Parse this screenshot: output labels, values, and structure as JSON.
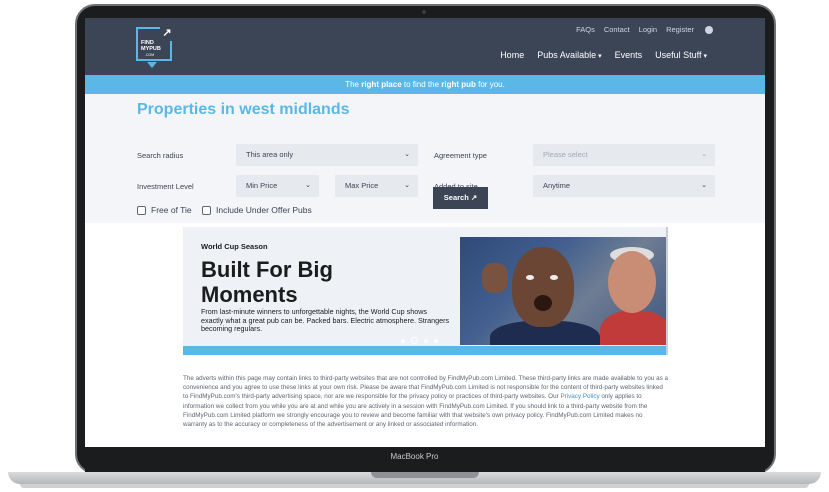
{
  "device": {
    "label": "MacBook Pro"
  },
  "header": {
    "logo": {
      "line1": "FIND",
      "line2": "MYPUB",
      "line3": ".COM"
    },
    "top_links": [
      "FAQs",
      "Contact",
      "Login",
      "Register"
    ],
    "nav": [
      {
        "label": "Home",
        "dropdown": false
      },
      {
        "label": "Pubs Available",
        "dropdown": true
      },
      {
        "label": "Events",
        "dropdown": false
      },
      {
        "label": "Useful Stuff",
        "dropdown": true
      }
    ]
  },
  "banner": {
    "pre": "The ",
    "b1": "right place",
    "mid": " to find the ",
    "b2": "right pub",
    "post": " for you."
  },
  "search": {
    "title": "Properties in west midlands",
    "radius_label": "Search radius",
    "radius_value": "This area only",
    "agreement_label": "Agreement type",
    "agreement_placeholder": "Please select",
    "investment_label": "Investment Level",
    "min_price": "Min Price",
    "max_price": "Max Price",
    "added_label": "Added to site",
    "added_value": "Anytime",
    "free_of_tie": "Free of Tie",
    "under_offer": "Include Under Offer Pubs",
    "search_button": "Search ↗"
  },
  "ad": {
    "kicker": "World Cup Season",
    "headline": "Built For Big Moments",
    "body": "From last-minute winners to unforgettable nights, the World Cup shows exactly what a great pub can be. Packed bars. Electric atmosphere. Strangers becoming regulars.",
    "slides": 4,
    "active_slide": 2
  },
  "disclaimer": {
    "part1": "The adverts within this page may contain links to third-party websites that are not controlled by FindMyPub.com Limited. These third-party links are made available to you as a convenience and you agree to use these links at your own risk. Please be aware that FindMyPub.com Limited is not responsible for the content of third-party websites linked to FindMyPub.com's third-party advertising space, nor are we responsible for the privacy policy or practices of third-party websites. Our ",
    "link": "Privacy Policy",
    "part2": " only applies to information we collect from you while you are at and while you are actively in a session with FindMyPub.com Limited. If you should link to a third-party website from the FindMyPub.com Limited platform we strongly encourage you to review and become familiar with that website's own privacy policy. FindMyPub.com Limited makes no warranty as to the accuracy or completeness of the advertisement or any linked or associated information."
  },
  "colors": {
    "brand_navy": "#3b4556",
    "brand_blue": "#5bb8e6"
  }
}
